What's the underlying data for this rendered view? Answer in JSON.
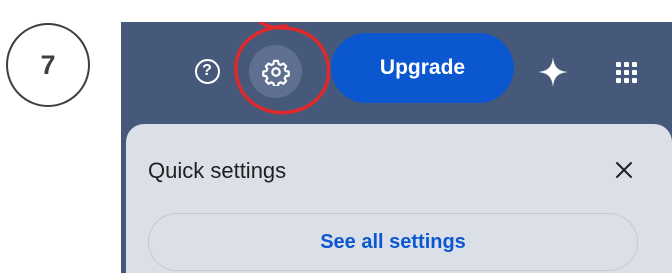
{
  "step": {
    "number": "7"
  },
  "header": {
    "help_icon": "help-circle-icon",
    "help_glyph": "?",
    "settings_icon": "gear-icon",
    "upgrade_label": "Upgrade",
    "sparkle_icon": "sparkle-icon",
    "apps_icon": "apps-grid-icon",
    "highlight_color": "#e0292d",
    "bar_color": "#46597a",
    "upgrade_color": "#0b57d0"
  },
  "quick_settings": {
    "title": "Quick settings",
    "close_icon": "close-icon",
    "see_all_label": "See all settings",
    "panel_color": "#dbe0e8"
  }
}
